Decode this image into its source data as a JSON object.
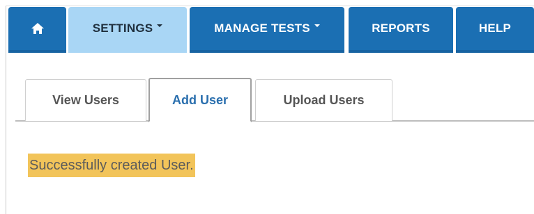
{
  "nav": {
    "home_icon": "home-icon",
    "items": [
      {
        "label": "SETTINGS",
        "dropdown": true,
        "active": true
      },
      {
        "label": "MANAGE TESTS",
        "dropdown": true,
        "active": false
      },
      {
        "label": "REPORTS",
        "dropdown": false,
        "active": false
      },
      {
        "label": "HELP",
        "dropdown": false,
        "active": false
      }
    ]
  },
  "tabs": [
    {
      "label": "View Users",
      "active": false
    },
    {
      "label": "Add User",
      "active": true
    },
    {
      "label": "Upload Users",
      "active": false
    }
  ],
  "alert": {
    "message": "Successfully created User."
  },
  "colors": {
    "nav_bg": "#1b6fb3",
    "nav_active_bg": "#a9d6f5",
    "tab_active_text": "#2a6fae",
    "alert_bg": "#f2c45a"
  }
}
